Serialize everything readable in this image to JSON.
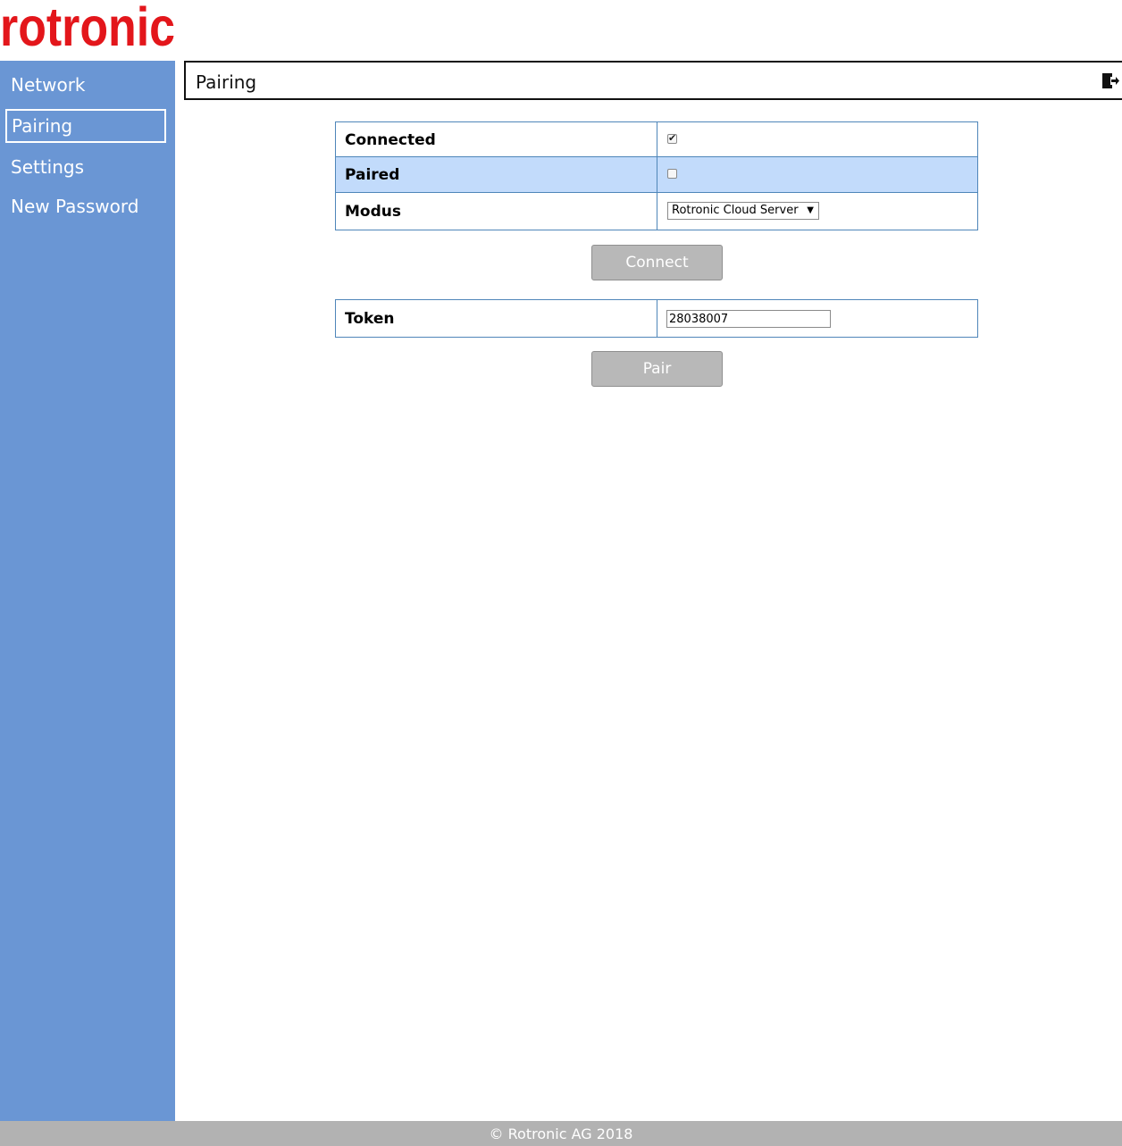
{
  "brand": {
    "logo_text": "rotronic",
    "logo_color": "#e3161b"
  },
  "sidebar": {
    "background": "#6a96d4",
    "items": [
      {
        "label": "Network",
        "active": false
      },
      {
        "label": "Pairing",
        "active": true
      },
      {
        "label": "Settings",
        "active": false
      },
      {
        "label": "New Password",
        "active": false
      }
    ]
  },
  "header": {
    "title": "Pairing",
    "logout_icon": "logout-icon"
  },
  "status_table": {
    "rows": [
      {
        "label": "Connected",
        "checked": true
      },
      {
        "label": "Paired",
        "checked": false
      },
      {
        "label": "Modus",
        "selected": "Rotronic Cloud Server"
      }
    ]
  },
  "connect_button": {
    "label": "Connect"
  },
  "token_table": {
    "label": "Token",
    "value": "28038007"
  },
  "pair_button": {
    "label": "Pair"
  },
  "footer": {
    "text": "© Rotronic AG 2018"
  }
}
